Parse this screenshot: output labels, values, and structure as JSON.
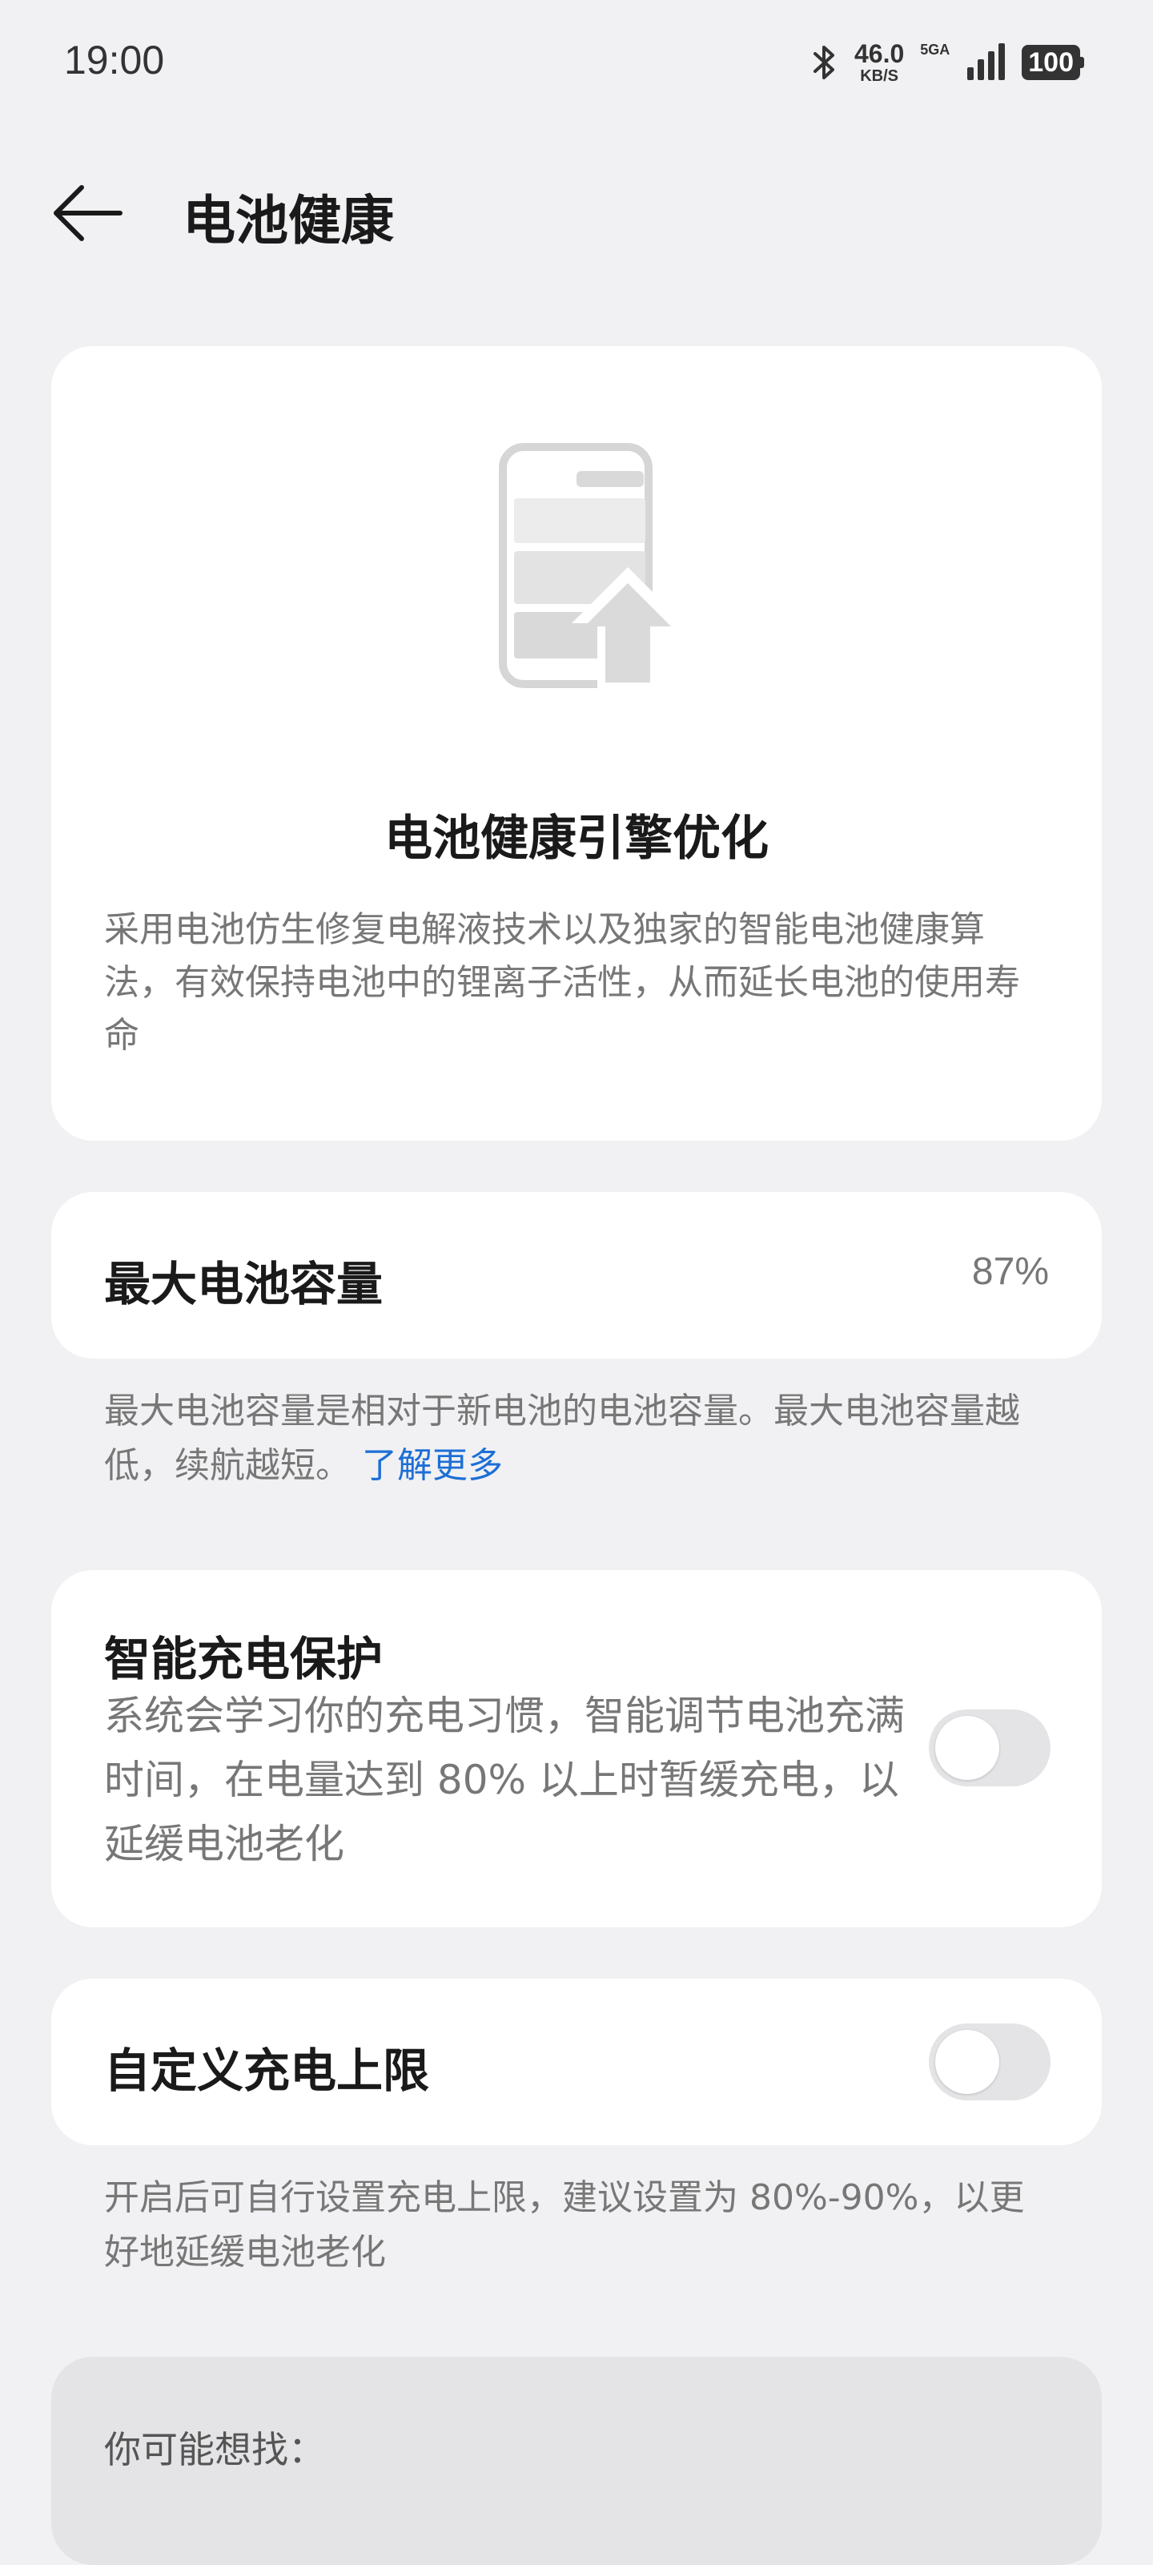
{
  "status_bar": {
    "time": "19:00",
    "speed_value": "46.0",
    "speed_unit": "KB/S",
    "network": "5GA",
    "battery": "100",
    "icons": [
      "bluetooth-icon",
      "signal-icon",
      "battery-icon"
    ]
  },
  "header": {
    "title": "电池健康",
    "back_icon": "back-arrow-icon"
  },
  "hero": {
    "icon": "battery-upgrade-icon",
    "title": "电池健康引擎优化",
    "description": "采用电池仿生修复电解液技术以及独家的智能电池健康算法，有效保持电池中的锂离子活性，从而延长电池的使用寿命"
  },
  "capacity": {
    "label": "最大电池容量",
    "value": "87%",
    "note": "最大电池容量是相对于新电池的电池容量。最大电池容量越低，续航越短。",
    "link": "了解更多"
  },
  "smart_charging": {
    "label": "智能充电保护",
    "description": "系统会学习你的充电习惯，智能调节电池充满时间，在电量达到 80% 以上时暂缓充电，以延缓电池老化",
    "enabled": false
  },
  "custom_limit": {
    "label": "自定义充电上限",
    "note": "开启后可自行设置充电上限，建议设置为 80%-90%，以更好地延缓电池老化",
    "enabled": false
  },
  "suggestions": {
    "label": "你可能想找："
  },
  "colors": {
    "background": "#f1f1f3",
    "card": "#ffffff",
    "link": "#1d6fd6",
    "toggle_off": "#e4e4e6"
  }
}
